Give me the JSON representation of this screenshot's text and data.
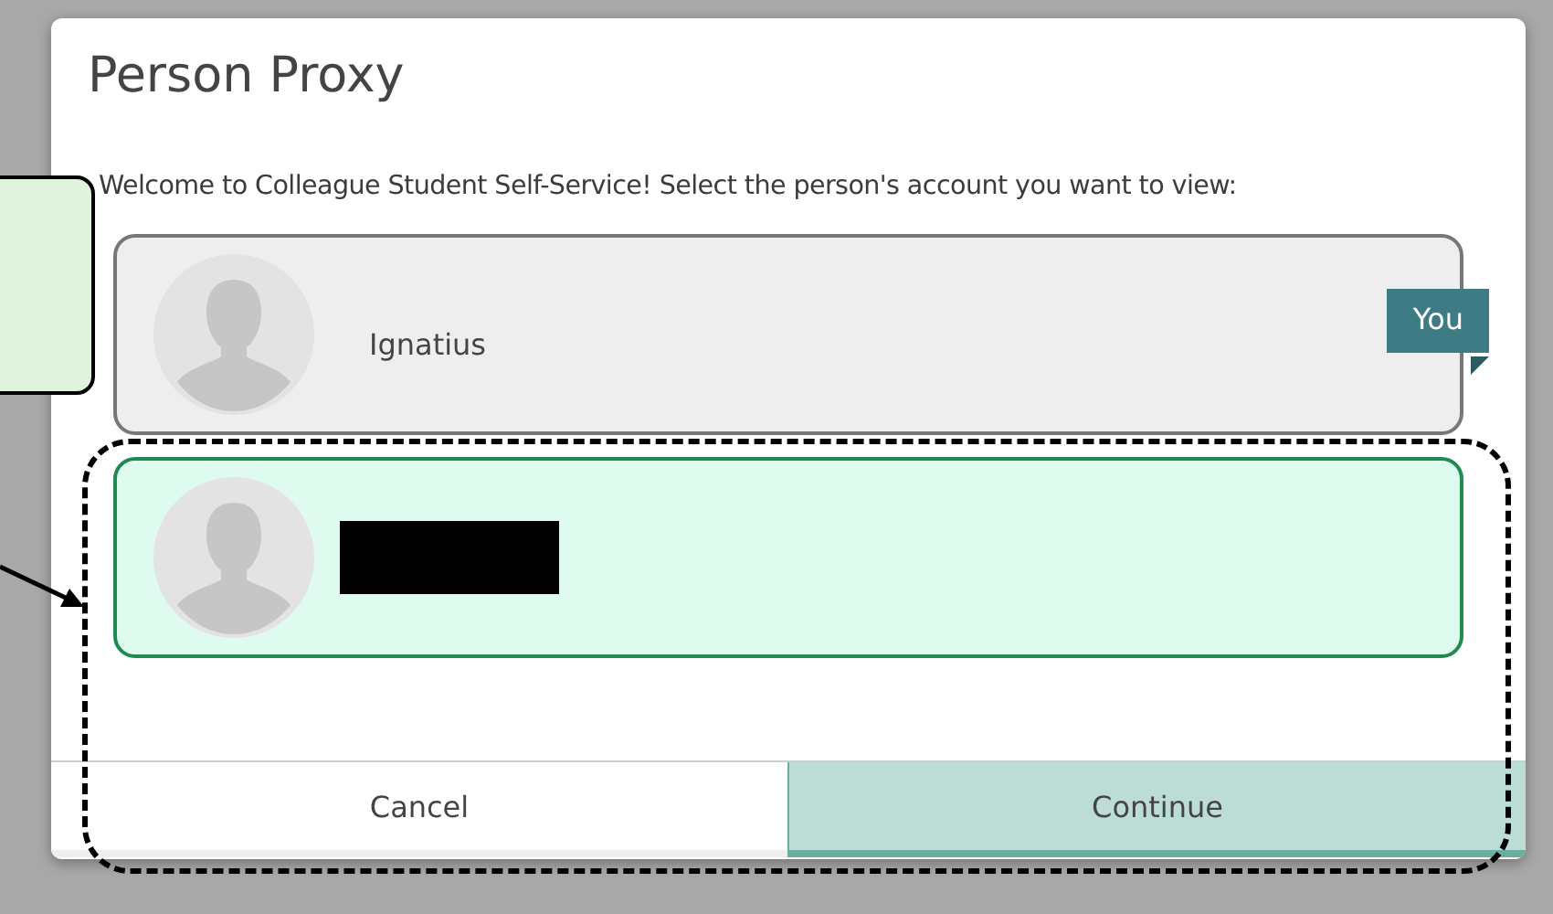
{
  "dialog": {
    "title": "Person Proxy",
    "message": "Welcome to Colleague Student Self-Service! Select the person's account you want to view:",
    "accounts": [
      {
        "name": "Ignatius",
        "badge": "You",
        "selected": false,
        "redacted": false
      },
      {
        "selected": true,
        "redacted": true
      }
    ],
    "buttons": [
      {
        "label": "Cancel",
        "kind": "secondary"
      },
      {
        "label": "Continue",
        "kind": "primary"
      }
    ]
  }
}
